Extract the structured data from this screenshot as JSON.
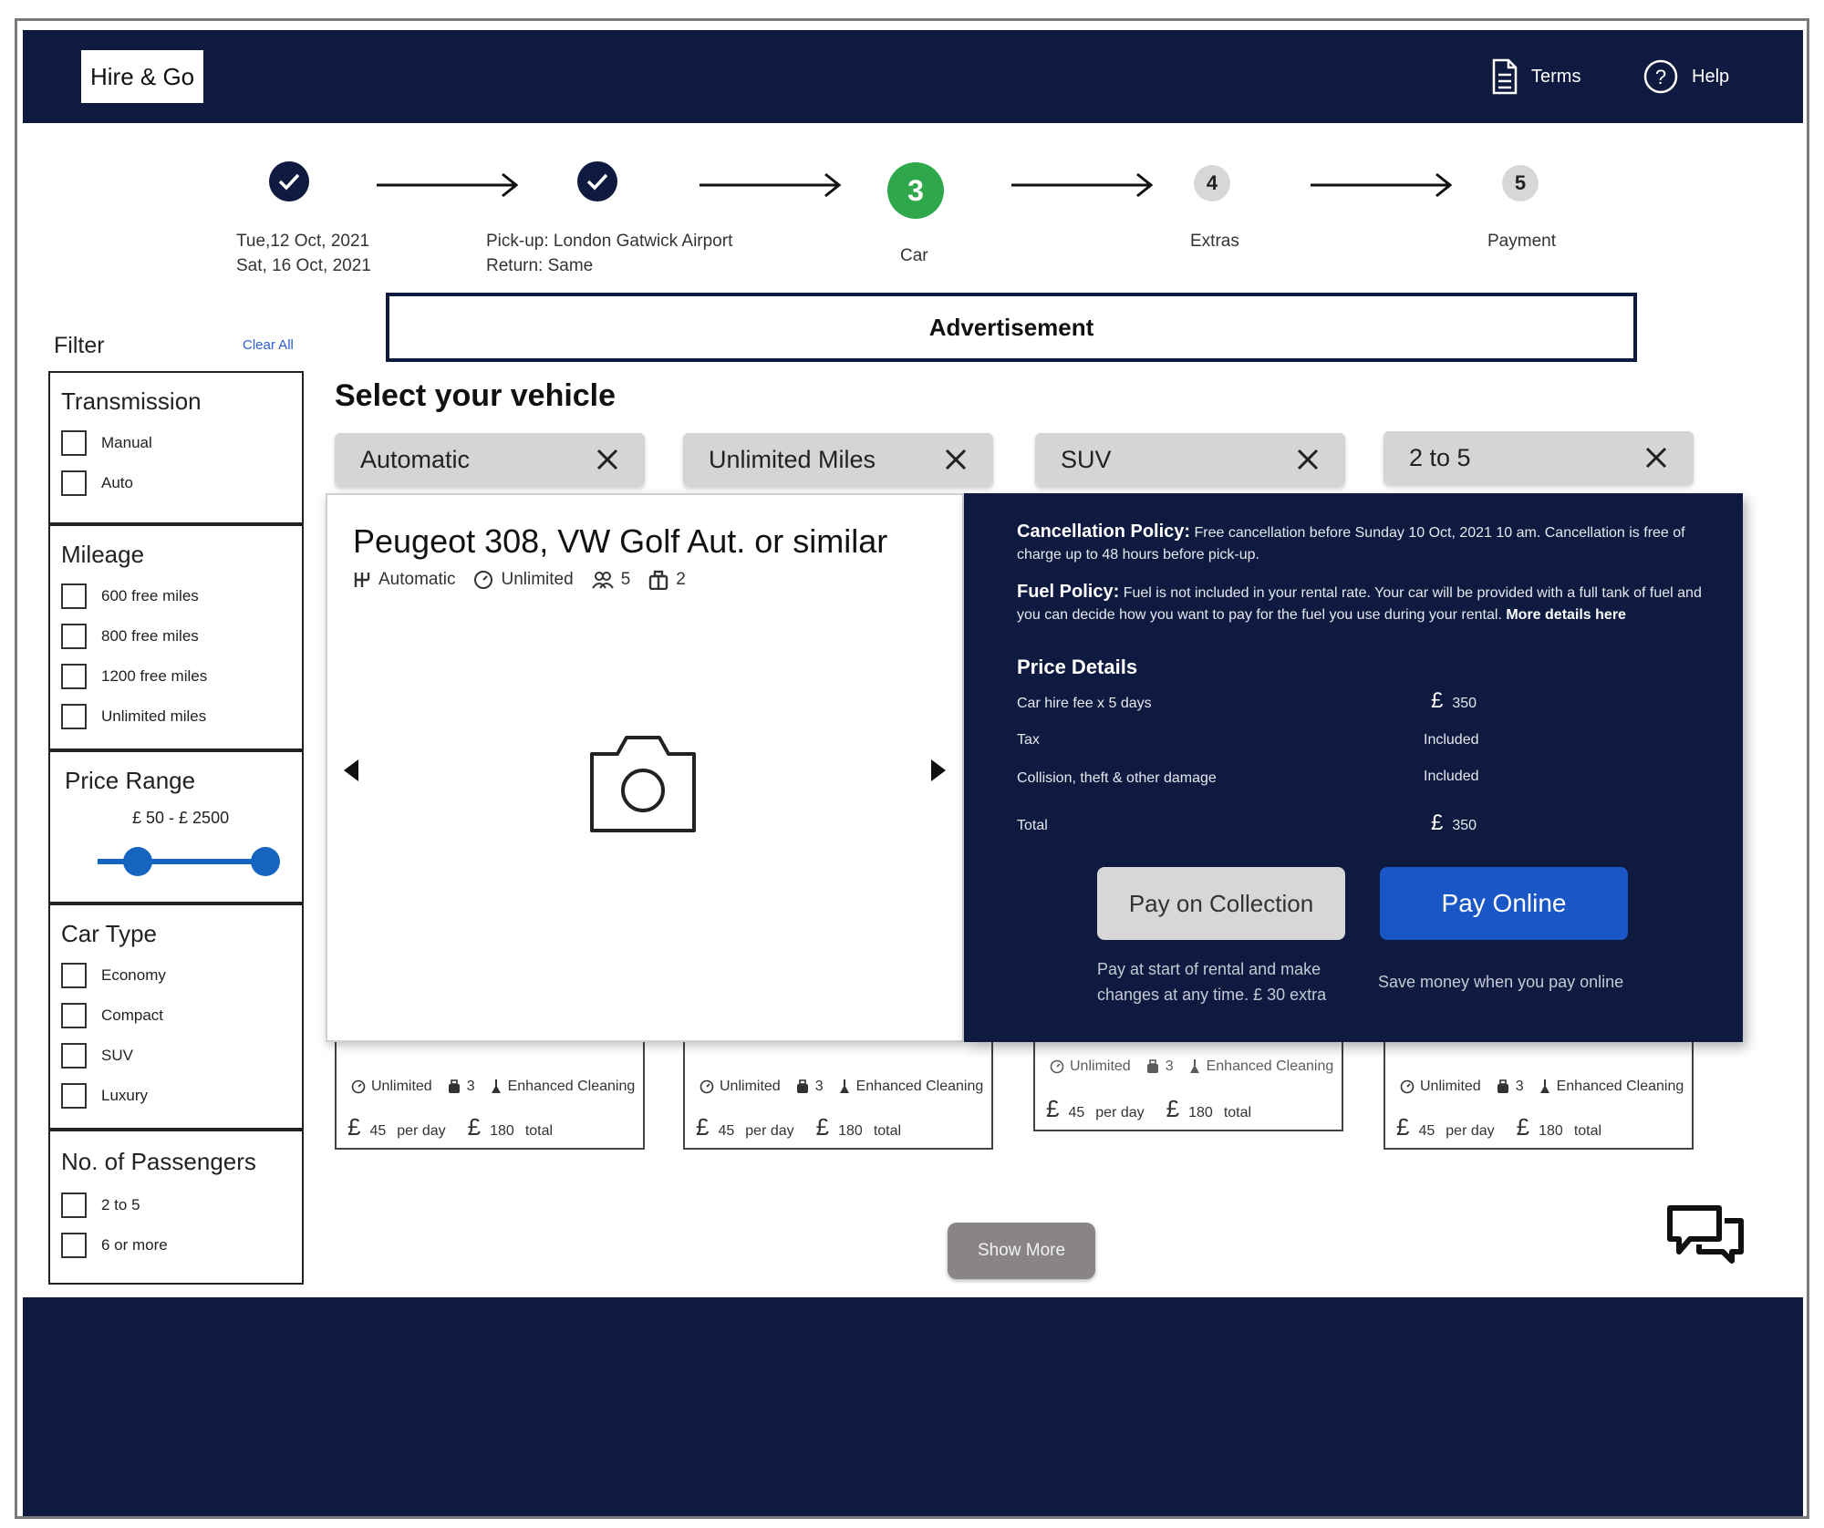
{
  "header": {
    "logo": "Hire & Go",
    "terms": "Terms",
    "help": "Help"
  },
  "stepper": {
    "step1": {
      "line1": "Tue,12 Oct, 2021",
      "line2": "Sat, 16 Oct, 2021"
    },
    "step2": {
      "line1": "Pick-up: London Gatwick Airport",
      "line2": "Return: Same"
    },
    "step3": {
      "number": "3",
      "label": "Car"
    },
    "step4": {
      "number": "4",
      "label": "Extras"
    },
    "step5": {
      "number": "5",
      "label": "Payment"
    }
  },
  "advertisement": "Advertisement",
  "filter": {
    "title": "Filter",
    "clear_all": "Clear All",
    "transmission": {
      "title": "Transmission",
      "options": [
        "Manual",
        "Auto"
      ]
    },
    "mileage": {
      "title": "Mileage",
      "options": [
        "600 free miles",
        "800 free miles",
        "1200 free miles",
        "Unlimited miles"
      ]
    },
    "price_range": {
      "title": "Price Range",
      "label": "£ 50 - £ 2500"
    },
    "car_type": {
      "title": "Car Type",
      "options": [
        "Economy",
        "Compact",
        "SUV",
        "Luxury"
      ]
    },
    "passengers": {
      "title": "No. of Passengers",
      "options": [
        "2 to 5",
        "6 or more"
      ]
    }
  },
  "main": {
    "title": "Select your vehicle",
    "chips": [
      "Automatic",
      "Unlimited Miles",
      "SUV",
      "2 to 5"
    ]
  },
  "cards": [
    {
      "mileage": "Unlimited",
      "bags": "3",
      "cleaning": "Enhanced Cleaning",
      "per_day": "45",
      "per_day_label": "per day",
      "total": "180",
      "total_label": "total"
    },
    {
      "mileage": "Unlimited",
      "bags": "3",
      "cleaning": "Enhanced Cleaning",
      "per_day": "45",
      "per_day_label": "per day",
      "total": "180",
      "total_label": "total"
    },
    {
      "mileage": "Unlimited",
      "bags": "3",
      "cleaning": "Enhanced Cleaning",
      "per_day": "45",
      "per_day_label": "per day",
      "total": "180",
      "total_label": "total"
    },
    {
      "mileage": "Unlimited",
      "bags": "3",
      "cleaning": "Enhanced Cleaning",
      "per_day": "45",
      "per_day_label": "per day",
      "total": "180",
      "total_label": "total"
    }
  ],
  "popup": {
    "car_name": "Peugeot 308, VW Golf Aut. or similar",
    "transmission": "Automatic",
    "mileage": "Unlimited",
    "passengers": "5",
    "bags": "2",
    "cancellation_title": "Cancellation Policy:",
    "cancellation_text": "Free cancellation before Sunday 10 Oct, 2021 10 am. Cancellation is free of charge up to 48 hours before pick-up.",
    "fuel_title": "Fuel Policy:",
    "fuel_text": "Fuel is not included in your rental rate. Your car will be provided with a full tank of fuel and you can decide how you want to pay for the fuel you use during your rental.",
    "fuel_link": "More details here",
    "price_details_title": "Price Details",
    "price_rows": [
      {
        "label": "Car hire fee x 5 days",
        "value": "350",
        "currency": "£"
      },
      {
        "label": "Tax",
        "value": "Included",
        "currency": ""
      },
      {
        "label": "Collision, theft & other damage",
        "value": "Included",
        "currency": ""
      },
      {
        "label": "Total",
        "value": "350",
        "currency": "£"
      }
    ],
    "pay_collection": "Pay on Collection",
    "pay_collection_note_1": "Pay at start of rental and make",
    "pay_collection_note_2": "changes at any time. £ 30 extra",
    "pay_online": "Pay Online",
    "pay_online_note": "Save money when you pay online"
  },
  "show_more": "Show More",
  "icons": [
    "document-icon",
    "help-icon",
    "check-icon",
    "arrow-right-icon",
    "close-icon",
    "gearbox-icon",
    "gauge-icon",
    "passengers-icon",
    "luggage-icon",
    "camera-icon",
    "chevron-left-icon",
    "chevron-right-icon",
    "chat-icon",
    "cleaning-icon"
  ],
  "colors": {
    "navy": "#0e1a3f",
    "green": "#2fa84b",
    "blue": "#1a57c6",
    "chip_gray": "#d5d5d5"
  }
}
